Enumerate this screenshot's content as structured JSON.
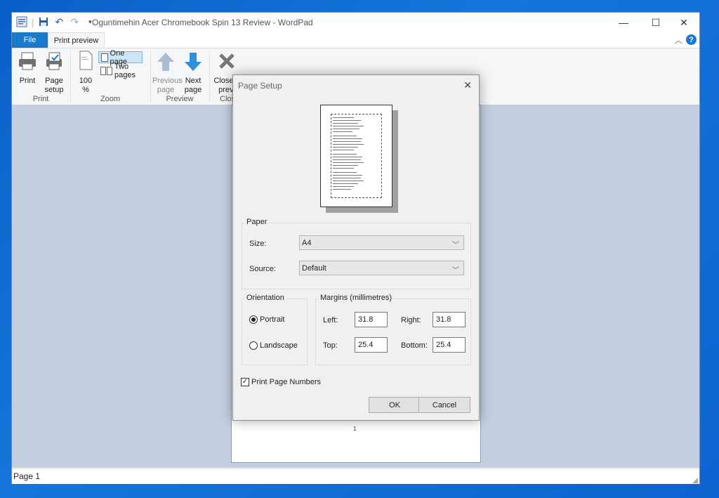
{
  "window": {
    "title": "Oguntimehin Acer Chromebook Spin 13 Review - WordPad",
    "controls": {
      "minimize": "—",
      "maximize": "☐",
      "close": "✕"
    }
  },
  "tabs": {
    "file": "File",
    "print_preview": "Print preview",
    "help": "?"
  },
  "ribbon": {
    "print": {
      "print": "Print",
      "page_setup_1": "Page",
      "page_setup_2": "setup",
      "group": "Print"
    },
    "zoom": {
      "zoom_1": "100",
      "zoom_2": "%",
      "one_page": "One page",
      "two_pages": "Two pages",
      "group": "Zoom"
    },
    "preview": {
      "prev_1": "Previous",
      "prev_2": "page",
      "next_1": "Next",
      "next_2": "page",
      "group": "Preview"
    },
    "close": {
      "close_1": "Close p",
      "close_2": "previ",
      "group": "Clos"
    }
  },
  "preview": {
    "page_number": "1"
  },
  "status": {
    "text": "Page 1"
  },
  "dialog": {
    "title": "Page Setup",
    "paper": {
      "legend": "Paper",
      "size_label": "Size:",
      "size_value": "A4",
      "source_label": "Source:",
      "source_value": "Default"
    },
    "orientation": {
      "legend": "Orientation",
      "portrait": "Portrait",
      "landscape": "Landscape",
      "selected": "Portrait"
    },
    "margins": {
      "legend": "Margins (millimetres)",
      "left_label": "Left:",
      "left": "31.8",
      "right_label": "Right:",
      "right": "31.8",
      "top_label": "Top:",
      "top": "25.4",
      "bottom_label": "Bottom:",
      "bottom": "25.4"
    },
    "print_page_numbers": {
      "label": "Print Page Numbers",
      "checked": true
    },
    "ok": "OK",
    "cancel": "Cancel"
  },
  "colors": {
    "accent": "#1979ca",
    "desktop": "#0d63cf",
    "preview_bg": "#c3cfe0"
  }
}
